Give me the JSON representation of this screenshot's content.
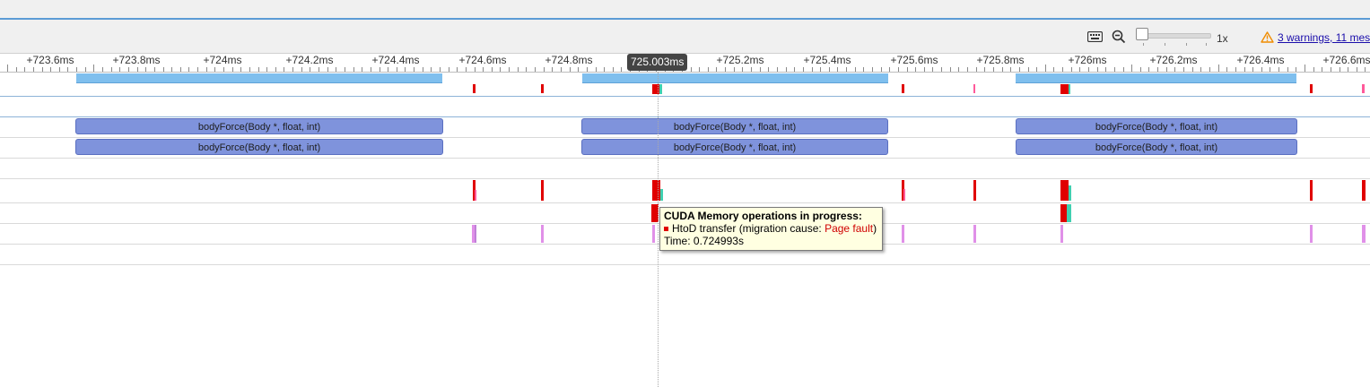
{
  "toolbar": {
    "keyboard_icon": "keyboard-icon",
    "zoom_out_icon": "zoom-out-icon",
    "zoom_level": "1x",
    "warning_icon": "warning-triangle-icon",
    "warnings_link": "3 warnings, 11 mes",
    "warning_color": "#f08c00"
  },
  "ruler": {
    "ticks": [
      "+723.6ms",
      "+723.8ms",
      "+724ms",
      "+724.2ms",
      "+724.4ms",
      "+724.6ms",
      "+724.8ms",
      "+725.2ms",
      "+725.4ms",
      "+725.6ms",
      "+725.8ms",
      "+726ms",
      "+726.2ms",
      "+726.4ms",
      "+726.6ms"
    ],
    "cursor_time": "725.003ms"
  },
  "timeline": {
    "kernel_label": "bodyForce(Body *, float, int)",
    "kernel_color": "#7f93dc",
    "activity_color": "#7fbfee",
    "htod_color": "#e00000",
    "dtoh_color": "#40d0b0",
    "fault_color": "#e090e8"
  },
  "tooltip": {
    "title": "CUDA Memory operations in progress:",
    "op_prefix": "HtoD transfer (migration cause: ",
    "op_cause": "Page fault",
    "op_suffix": ")",
    "time": "Time: 0.724993s"
  }
}
